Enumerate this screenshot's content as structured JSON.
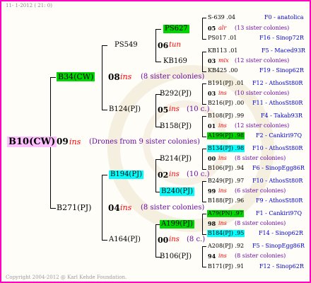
{
  "header": "11-  1-2012 ( 21:  0)",
  "footer": "Copyright 2004-2012 @ Karl Kehde Foundation.",
  "colors": {
    "frame": "#ff00c0",
    "green": "#00d700",
    "cyan": "#00ffff",
    "pink": "#ffc0ff",
    "ins": "#ff0000",
    "note": "#6a0aa0",
    "loc": "#0000c8"
  },
  "root": {
    "label": "B10(CW)",
    "num": "09",
    "ins": "ins",
    "note": "(Drones from 9 sister colonies)"
  },
  "upper": {
    "label": "B34(CW)",
    "num": "08",
    "ins": "ins",
    "note": "(8 sister colonies)",
    "a": {
      "label": "PS549",
      "num": "06",
      "ins": "tun",
      "p1": {
        "label": "PS627"
      },
      "p2": {
        "label": "KB169"
      },
      "l": [
        {
          "name": "S-639 .04",
          "loc": "F0 - anatolica"
        },
        {
          "num": "05",
          "ins": "alr",
          "note": "(13 sister colonies)"
        },
        {
          "name": "PS017 .01",
          "loc": "F16 - Sinop72R"
        },
        {
          "name": "KB113 .01",
          "loc": "F5 - Maced93R"
        },
        {
          "num": "03",
          "ins": "mix",
          "note": "(12 sister colonies)"
        },
        {
          "name": "KB425 .00",
          "loc": "F19 - Sinop62R"
        }
      ]
    },
    "b": {
      "label": "B124(PJ)",
      "num": "05",
      "ins": "ins",
      "note": "(10 c.)",
      "p1": {
        "label": "B292(PJ)"
      },
      "p2": {
        "label": "B158(PJ)"
      },
      "l": [
        {
          "name": "B191(PJ) .01",
          "loc": "F12 - AthosSt80R"
        },
        {
          "num": "03",
          "ins": "ins",
          "note": "(10 sister colonies)"
        },
        {
          "name": "B216(PJ) .00",
          "loc": "F11 - AthosSt80R"
        },
        {
          "name": "B108(PJ) .99",
          "loc": "F4 - Takab93R"
        },
        {
          "num": "01",
          "ins": "ins",
          "note": "(12 sister colonies)"
        },
        {
          "name": "A199(PJ) .98",
          "loc": "F2 - Cankiri97Q"
        }
      ]
    }
  },
  "lower": {
    "label": "B271(PJ)",
    "num": "04",
    "ins": "ins",
    "note": "(8 sister colonies)",
    "a": {
      "label": "B194(PJ)",
      "num": "02",
      "ins": "ins",
      "note": "(10 c.)",
      "p1": {
        "label": "B214(PJ)"
      },
      "p2": {
        "label": "B240(PJ)"
      },
      "l": [
        {
          "name": "B134(PJ) .98",
          "loc": "F10 - AthosSt80R"
        },
        {
          "num": "00",
          "ins": "ins",
          "note": "(8 sister colonies)"
        },
        {
          "name": "B106(PJ) .94",
          "loc": "F6 - SinopEgg86R"
        },
        {
          "name": "B249(PJ) .97",
          "loc": "F10 - AthosSt80R"
        },
        {
          "num": "99",
          "ins": "ins",
          "note": "(6 sister colonies)"
        },
        {
          "name": "B188(PJ) .96",
          "loc": "F9 - AthosSt80R"
        }
      ]
    },
    "b": {
      "label": "A164(PJ)",
      "num": "00",
      "ins": "ins",
      "note": "(8 c.)",
      "p1": {
        "label": "A199(PJ)"
      },
      "p2": {
        "label": "B106(PJ)"
      },
      "l": [
        {
          "name": "A79(PN) .97",
          "loc": "F1 - Cankiri97Q"
        },
        {
          "num": "98",
          "ins": "ins",
          "note": "(8 sister colonies)"
        },
        {
          "name": "B184(PJ) .95",
          "loc": "F14 - Sinop62R"
        },
        {
          "name": "A208(PJ) .92",
          "loc": "F5 - SinopEgg86R"
        },
        {
          "num": "94",
          "ins": "ins",
          "note": "(8 sister colonies)"
        },
        {
          "name": "B171(PJ) .91",
          "loc": "F12 - Sinop62R"
        }
      ]
    }
  }
}
